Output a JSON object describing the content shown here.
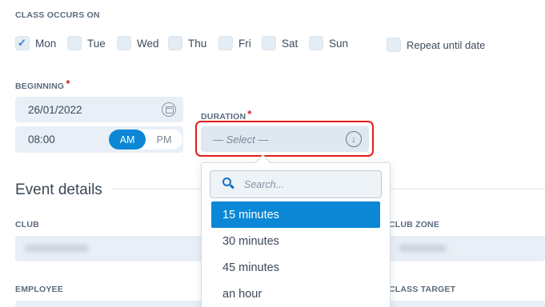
{
  "schedule": {
    "label": "CLASS OCCURS ON",
    "days": [
      {
        "label": "Mon",
        "checked": true
      },
      {
        "label": "Tue",
        "checked": false
      },
      {
        "label": "Wed",
        "checked": false
      },
      {
        "label": "Thu",
        "checked": false
      },
      {
        "label": "Fri",
        "checked": false
      },
      {
        "label": "Sat",
        "checked": false
      },
      {
        "label": "Sun",
        "checked": false
      }
    ],
    "repeat_label": "Repeat until date",
    "check_glyph": "✓"
  },
  "beginning": {
    "label": "BEGINNING",
    "required_mark": "*",
    "date": "26/01/2022",
    "time": "08:00",
    "am": "AM",
    "pm": "PM",
    "selected_period": "AM"
  },
  "duration": {
    "label": "DURATION",
    "required_mark": "*",
    "placeholder": "— Select —",
    "arrow_glyph": "↓",
    "search_placeholder": "Search...",
    "options": [
      "15 minutes",
      "30 minutes",
      "45 minutes",
      "an hour"
    ],
    "selected_option": "15 minutes"
  },
  "event_details": {
    "heading": "Event details",
    "club_label": "CLUB",
    "club_zone_label": "CLUB ZONE",
    "employee_label": "EMPLOYEE",
    "class_target_label": "CLASS TARGET"
  },
  "colors": {
    "accent": "#0b87d6",
    "highlight_border": "#e21c1c",
    "required": "#d0202a"
  }
}
